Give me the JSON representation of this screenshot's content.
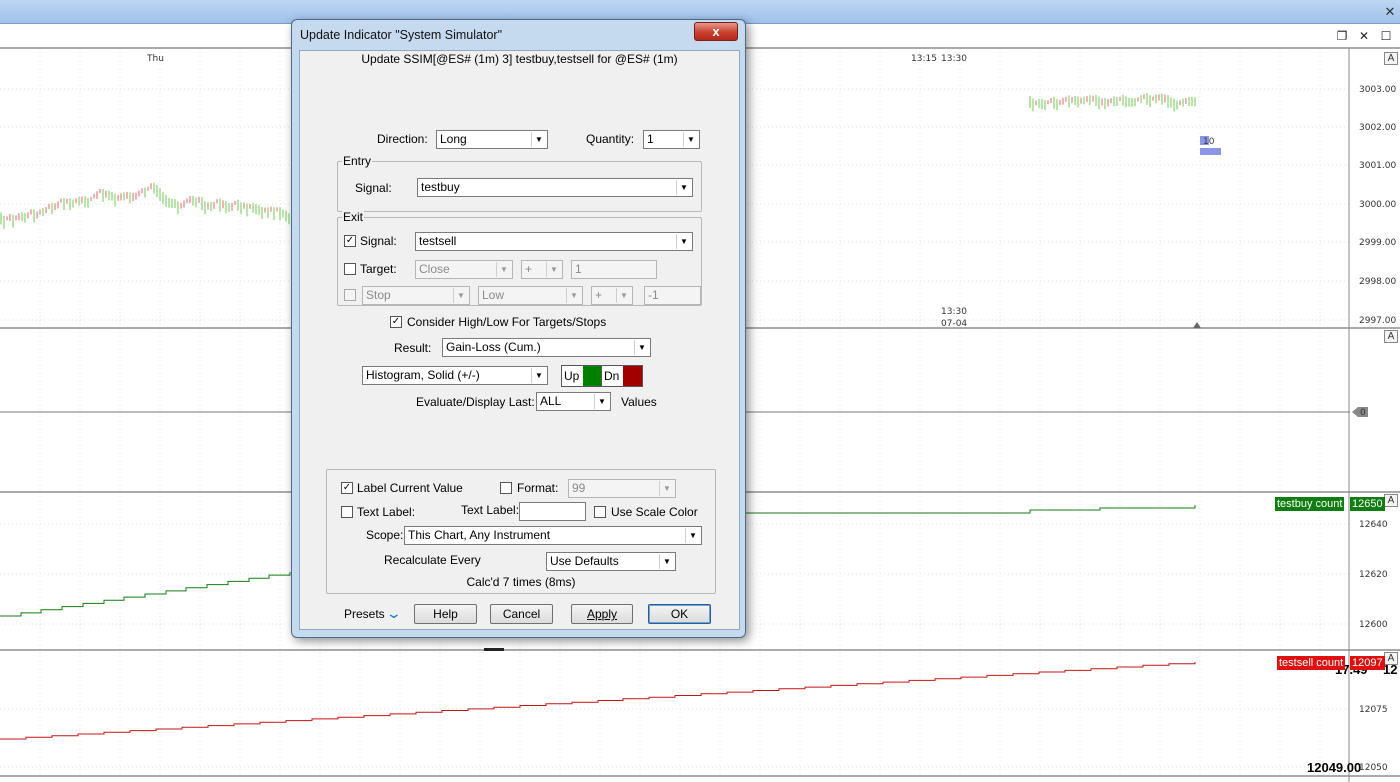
{
  "chart": {
    "time_labels": {
      "thu": "Thu",
      "t1315": "13:15",
      "t1330": "13:30",
      "t1330b": "13:30",
      "date": "07-04"
    },
    "price_axis": [
      "3003.00",
      "3002.00",
      "3001.00",
      "3000.00",
      "2999.00",
      "2998.00",
      "2997.00"
    ],
    "zero_label": "0",
    "price_marker": "10",
    "mid_axis": [
      "12640",
      "12620",
      "12600"
    ],
    "low_axis": [
      "17.49",
      "12075",
      "12050"
    ],
    "overlay_right": "12",
    "bottom_value": "12049.00",
    "scale_button": "A",
    "testbuy_label": "testbuy count",
    "testbuy_value": "12650",
    "testsell_label": "testsell count",
    "testsell_value": "12097",
    "colors": {
      "up": "#009000",
      "down": "#c00000",
      "bars_up": "#b5e6a8",
      "bars_down": "#f0b3b3",
      "marker": "#8c96e6"
    }
  },
  "dialog": {
    "title": "Update Indicator \"System Simulator\"",
    "close_label": "x",
    "subtitle": "Update SSIM[@ES# (1m) 3] testbuy,testsell for @ES# (1m)",
    "direction_label": "Direction:",
    "direction_value": "Long",
    "quantity_label": "Quantity:",
    "quantity_value": "1",
    "entry": {
      "title": "Entry",
      "signal_label": "Signal:",
      "signal_value": "testbuy"
    },
    "exit": {
      "title": "Exit",
      "signal_checked": true,
      "signal_label": "Signal:",
      "signal_value": "testsell",
      "target_label": "Target:",
      "target_field": "Close",
      "target_op": "+",
      "target_amount": "1",
      "stop_field": "Stop",
      "stop_basis": "Low",
      "stop_op": "+",
      "stop_amount": "-1"
    },
    "consider_label": "Consider High/Low For Targets/Stops",
    "result_label": "Result:",
    "result_value": "Gain-Loss (Cum.)",
    "style_value": "Histogram, Solid (+/-)",
    "up_label": "Up",
    "dn_label": "Dn",
    "up_color": "#008000",
    "dn_color": "#a00000",
    "evaluate_label": "Evaluate/Display Last:",
    "evaluate_value": "ALL",
    "values_label": "Values",
    "label_current_value": "Label Current Value",
    "format_label": "Format:",
    "format_value": "99",
    "text_label_check": "Text Label:",
    "text_label_field": "Text Label:",
    "text_label_value": "",
    "use_scale_color": "Use Scale Color",
    "scope_label": "Scope:",
    "scope_value": "This Chart, Any Instrument",
    "recalc_label": "Recalculate Every",
    "recalc_value": "Use Defaults",
    "calc_info": "Calc'd 7 times (8ms)",
    "presets_label": "Presets",
    "help_label": "Help",
    "cancel_label": "Cancel",
    "apply_label": "Apply",
    "ok_label": "OK",
    "check_mark": "✓"
  }
}
